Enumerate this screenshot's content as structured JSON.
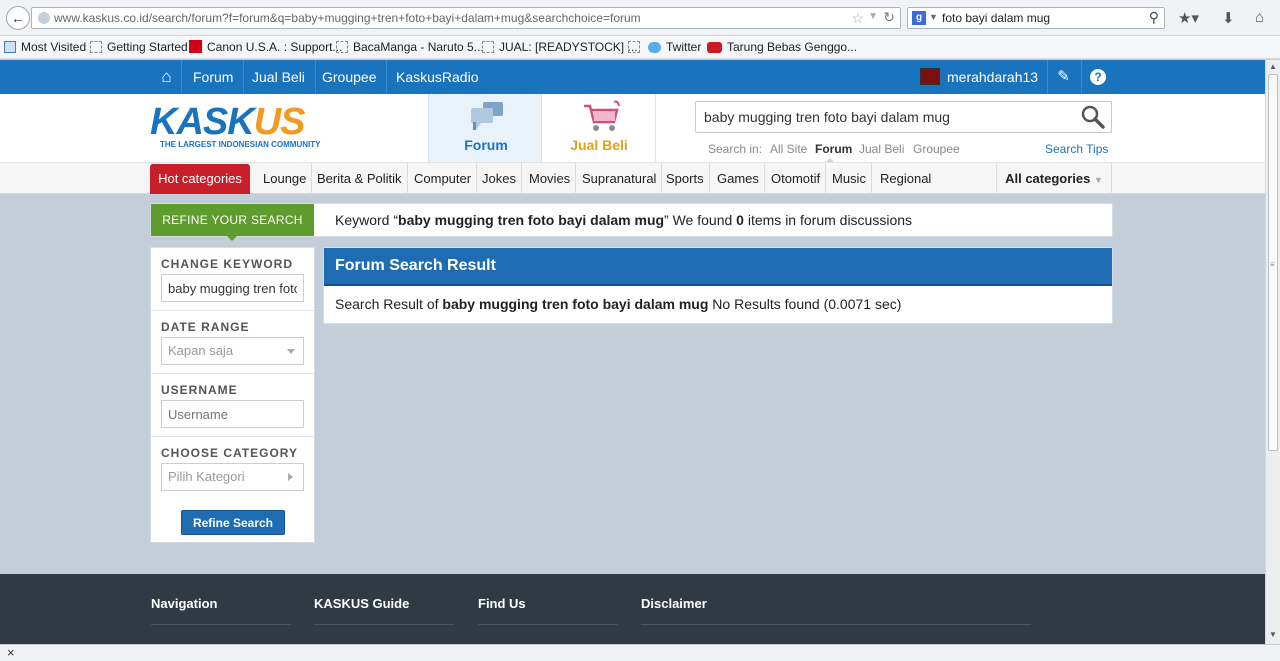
{
  "browser": {
    "url": "www.kaskus.co.id/search/forum?f=forum&q=baby+mugging+tren+foto+bayi+dalam+mug&searchchoice=forum",
    "search_query": "foto bayi dalam mug",
    "search_engine_icon": "g",
    "bookmarks": [
      {
        "label": "Most Visited",
        "icon": "most-visited-icon"
      },
      {
        "label": "Getting Started",
        "icon": "page-icon"
      },
      {
        "label": "Canon U.S.A. : Support...",
        "icon": "canon-icon"
      },
      {
        "label": "BacaManga - Naruto 5...",
        "icon": "page-icon"
      },
      {
        "label": "JUAL: [READYSTOCK] ...",
        "icon": "page-icon"
      },
      {
        "label": "Twitter",
        "icon": "twitter-icon"
      },
      {
        "label": "Tarung Bebas Genggo...",
        "icon": "youtube-icon"
      }
    ]
  },
  "topnav": {
    "items": [
      "Forum",
      "Jual Beli",
      "Groupee",
      "KaskusRadio"
    ],
    "username": "merahdarah13",
    "help_label": "?"
  },
  "header": {
    "logo_main": "KASK",
    "logo_accent": "US",
    "logo_tagline": "THE LARGEST INDONESIAN COMMUNITY",
    "tab_forum": "Forum",
    "tab_jualbeli": "Jual Beli",
    "search_value": "baby mugging tren foto bayi dalam mug",
    "search_in_label": "Search in:",
    "scopes": [
      "All Site",
      "Forum",
      "Jual Beli",
      "Groupee"
    ],
    "search_tips": "Search Tips"
  },
  "categories": {
    "hot": "Hot categories",
    "items": [
      "Lounge",
      "Berita & Politik",
      "Computer",
      "Jokes",
      "Movies",
      "Supranatural",
      "Sports",
      "Games",
      "Otomotif",
      "Music",
      "Regional"
    ],
    "all": "All categories"
  },
  "refine": {
    "label": "REFINE YOUR SEARCH",
    "keyword_prefix": "Keyword “",
    "keyword": "baby mugging tren foto bayi dalam mug",
    "keyword_mid": "” We found ",
    "count": "0",
    "suffix": " items in forum discussions"
  },
  "sidebar": {
    "change_keyword_label": "CHANGE KEYWORD",
    "keyword_value": "baby mugging tren foto bayi dalam mug",
    "date_range_label": "DATE RANGE",
    "date_range_value": "Kapan saja",
    "username_label": "USERNAME",
    "username_placeholder": "Username",
    "category_label": "CHOOSE CATEGORY",
    "category_value": "Pilih Kategori",
    "refine_button": "Refine Search"
  },
  "results": {
    "title": "Forum Search Result",
    "prefix": "Search Result of ",
    "keyword": "baby mugging tren foto bayi dalam mug",
    "suffix": " No Results found (0.0071 sec)"
  },
  "footer": {
    "columns": [
      "Navigation",
      "KASKUS Guide",
      "Find Us",
      "Disclaimer"
    ]
  },
  "colors": {
    "brand_blue": "#1a73bd",
    "refine_green": "#5f9c2e",
    "hot_red": "#c8202a"
  }
}
